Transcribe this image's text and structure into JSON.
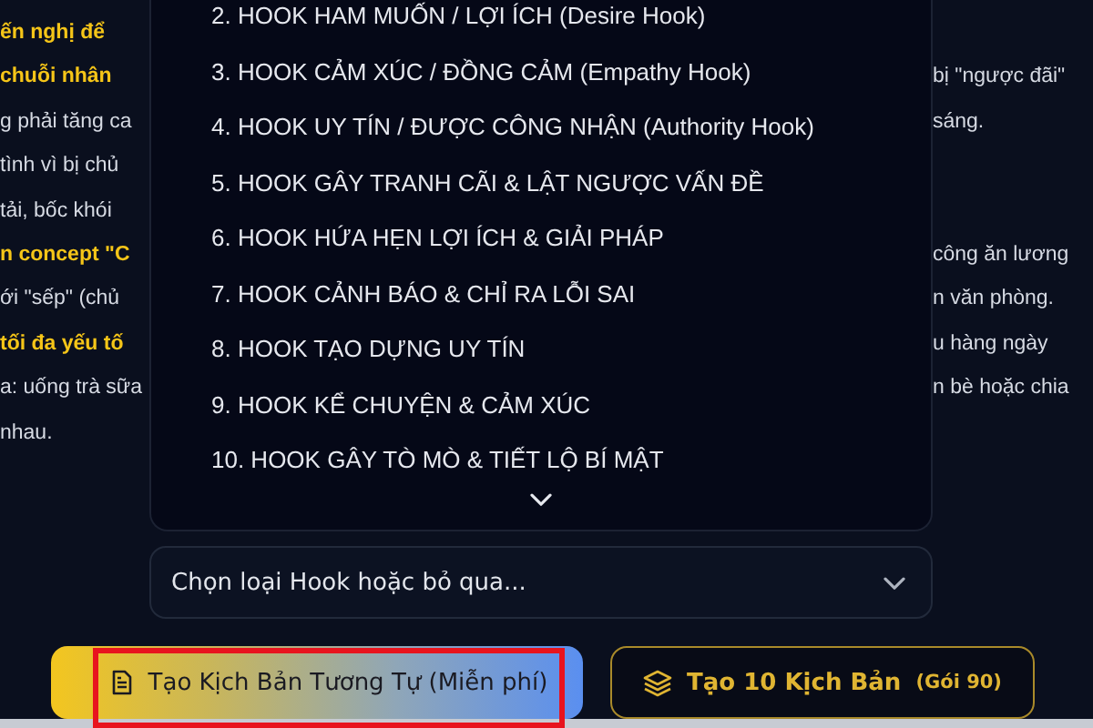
{
  "background_text": {
    "lines": [
      {
        "left": {
          "text": "ến nghị để",
          "highlight": true
        }
      },
      {
        "left": {
          "text": "chuỗi nhân",
          "highlight": true
        },
        "right": "bị \"ngược đãi\""
      },
      {
        "left": {
          "text": "g phải tăng ca",
          "highlight": false
        },
        "right": "sáng."
      },
      {
        "left": {
          "text": "tình vì bị chủ",
          "highlight": false
        }
      },
      {
        "left": {
          "text": "tải, bốc khói",
          "highlight": false
        }
      },
      {
        "left": {
          "text": "n concept \"C",
          "highlight": true
        },
        "right": "công ăn lương"
      },
      {
        "left": {
          "text": "ới \"sếp\" (chủ",
          "highlight": false
        },
        "right": "n văn phòng."
      },
      {
        "left": {
          "text": "tối đa yếu tố",
          "highlight": true
        },
        "right": "u hàng ngày"
      },
      {
        "left": {
          "text": "a: uống trà sữa",
          "highlight": false
        },
        "right": "n bè hoặc chia"
      },
      {
        "left": {
          "text": "nhau.",
          "highlight": false
        }
      }
    ]
  },
  "hook_menu": {
    "items": [
      "2. HOOK HAM MUỐN / LỢI ÍCH (Desire Hook)",
      "3. HOOK CẢM XÚC / ĐỒNG CẢM (Empathy Hook)",
      "4. HOOK UY TÍN / ĐƯỢC CÔNG NHẬN (Authority Hook)",
      "5. HOOK GÂY TRANH CÃI & LẬT NGƯỢC VẤN ĐỀ",
      "6. HOOK HỨA HẸN LỢI ÍCH & GIẢI PHÁP",
      "7. HOOK CẢNH BÁO & CHỈ RA LỖI SAI",
      "8. HOOK TẠO DỰNG UY TÍN",
      "9. HOOK KỂ CHUYỆN & CẢM XÚC",
      "10. HOOK GÂY TÒ MÒ & TIẾT LỘ BÍ MẬT"
    ]
  },
  "hook_select": {
    "placeholder": "Chọn loại Hook hoặc bỏ qua..."
  },
  "buttons": [
    {
      "kind": "primary",
      "label": "Tạo Kịch Bản Tương Tự (Miễn phí)",
      "highlighted": true
    },
    {
      "kind": "secondary",
      "label": "Tạo 10 Kịch Bản",
      "note": "(Gói 90)",
      "highlighted": false
    }
  ]
}
